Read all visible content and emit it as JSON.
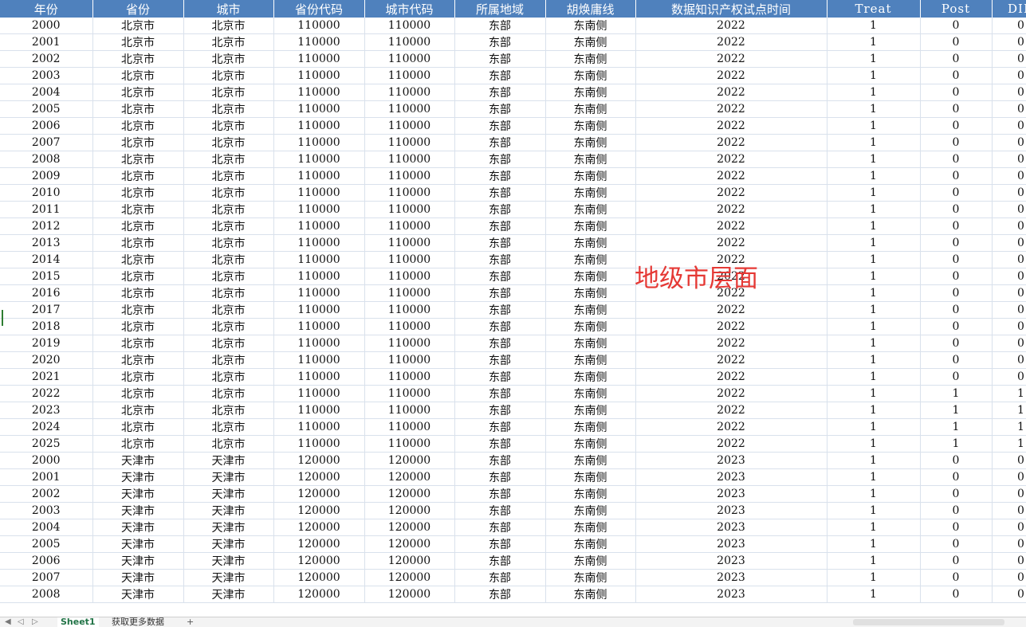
{
  "headers": [
    "年份",
    "省份",
    "城市",
    "省份代码",
    "城市代码",
    "所属地域",
    "胡焕庸线",
    "数据知识产权试点时间",
    "Treat",
    "Post",
    "DID"
  ],
  "rows": [
    [
      "2000",
      "北京市",
      "北京市",
      "110000",
      "110000",
      "东部",
      "东南侧",
      "2022",
      "1",
      "0",
      "0"
    ],
    [
      "2001",
      "北京市",
      "北京市",
      "110000",
      "110000",
      "东部",
      "东南侧",
      "2022",
      "1",
      "0",
      "0"
    ],
    [
      "2002",
      "北京市",
      "北京市",
      "110000",
      "110000",
      "东部",
      "东南侧",
      "2022",
      "1",
      "0",
      "0"
    ],
    [
      "2003",
      "北京市",
      "北京市",
      "110000",
      "110000",
      "东部",
      "东南侧",
      "2022",
      "1",
      "0",
      "0"
    ],
    [
      "2004",
      "北京市",
      "北京市",
      "110000",
      "110000",
      "东部",
      "东南侧",
      "2022",
      "1",
      "0",
      "0"
    ],
    [
      "2005",
      "北京市",
      "北京市",
      "110000",
      "110000",
      "东部",
      "东南侧",
      "2022",
      "1",
      "0",
      "0"
    ],
    [
      "2006",
      "北京市",
      "北京市",
      "110000",
      "110000",
      "东部",
      "东南侧",
      "2022",
      "1",
      "0",
      "0"
    ],
    [
      "2007",
      "北京市",
      "北京市",
      "110000",
      "110000",
      "东部",
      "东南侧",
      "2022",
      "1",
      "0",
      "0"
    ],
    [
      "2008",
      "北京市",
      "北京市",
      "110000",
      "110000",
      "东部",
      "东南侧",
      "2022",
      "1",
      "0",
      "0"
    ],
    [
      "2009",
      "北京市",
      "北京市",
      "110000",
      "110000",
      "东部",
      "东南侧",
      "2022",
      "1",
      "0",
      "0"
    ],
    [
      "2010",
      "北京市",
      "北京市",
      "110000",
      "110000",
      "东部",
      "东南侧",
      "2022",
      "1",
      "0",
      "0"
    ],
    [
      "2011",
      "北京市",
      "北京市",
      "110000",
      "110000",
      "东部",
      "东南侧",
      "2022",
      "1",
      "0",
      "0"
    ],
    [
      "2012",
      "北京市",
      "北京市",
      "110000",
      "110000",
      "东部",
      "东南侧",
      "2022",
      "1",
      "0",
      "0"
    ],
    [
      "2013",
      "北京市",
      "北京市",
      "110000",
      "110000",
      "东部",
      "东南侧",
      "2022",
      "1",
      "0",
      "0"
    ],
    [
      "2014",
      "北京市",
      "北京市",
      "110000",
      "110000",
      "东部",
      "东南侧",
      "2022",
      "1",
      "0",
      "0"
    ],
    [
      "2015",
      "北京市",
      "北京市",
      "110000",
      "110000",
      "东部",
      "东南侧",
      "2022",
      "1",
      "0",
      "0"
    ],
    [
      "2016",
      "北京市",
      "北京市",
      "110000",
      "110000",
      "东部",
      "东南侧",
      "2022",
      "1",
      "0",
      "0"
    ],
    [
      "2017",
      "北京市",
      "北京市",
      "110000",
      "110000",
      "东部",
      "东南侧",
      "2022",
      "1",
      "0",
      "0"
    ],
    [
      "2018",
      "北京市",
      "北京市",
      "110000",
      "110000",
      "东部",
      "东南侧",
      "2022",
      "1",
      "0",
      "0"
    ],
    [
      "2019",
      "北京市",
      "北京市",
      "110000",
      "110000",
      "东部",
      "东南侧",
      "2022",
      "1",
      "0",
      "0"
    ],
    [
      "2020",
      "北京市",
      "北京市",
      "110000",
      "110000",
      "东部",
      "东南侧",
      "2022",
      "1",
      "0",
      "0"
    ],
    [
      "2021",
      "北京市",
      "北京市",
      "110000",
      "110000",
      "东部",
      "东南侧",
      "2022",
      "1",
      "0",
      "0"
    ],
    [
      "2022",
      "北京市",
      "北京市",
      "110000",
      "110000",
      "东部",
      "东南侧",
      "2022",
      "1",
      "1",
      "1"
    ],
    [
      "2023",
      "北京市",
      "北京市",
      "110000",
      "110000",
      "东部",
      "东南侧",
      "2022",
      "1",
      "1",
      "1"
    ],
    [
      "2024",
      "北京市",
      "北京市",
      "110000",
      "110000",
      "东部",
      "东南侧",
      "2022",
      "1",
      "1",
      "1"
    ],
    [
      "2025",
      "北京市",
      "北京市",
      "110000",
      "110000",
      "东部",
      "东南侧",
      "2022",
      "1",
      "1",
      "1"
    ],
    [
      "2000",
      "天津市",
      "天津市",
      "120000",
      "120000",
      "东部",
      "东南侧",
      "2023",
      "1",
      "0",
      "0"
    ],
    [
      "2001",
      "天津市",
      "天津市",
      "120000",
      "120000",
      "东部",
      "东南侧",
      "2023",
      "1",
      "0",
      "0"
    ],
    [
      "2002",
      "天津市",
      "天津市",
      "120000",
      "120000",
      "东部",
      "东南侧",
      "2023",
      "1",
      "0",
      "0"
    ],
    [
      "2003",
      "天津市",
      "天津市",
      "120000",
      "120000",
      "东部",
      "东南侧",
      "2023",
      "1",
      "0",
      "0"
    ],
    [
      "2004",
      "天津市",
      "天津市",
      "120000",
      "120000",
      "东部",
      "东南侧",
      "2023",
      "1",
      "0",
      "0"
    ],
    [
      "2005",
      "天津市",
      "天津市",
      "120000",
      "120000",
      "东部",
      "东南侧",
      "2023",
      "1",
      "0",
      "0"
    ],
    [
      "2006",
      "天津市",
      "天津市",
      "120000",
      "120000",
      "东部",
      "东南侧",
      "2023",
      "1",
      "0",
      "0"
    ],
    [
      "2007",
      "天津市",
      "天津市",
      "120000",
      "120000",
      "东部",
      "东南侧",
      "2023",
      "1",
      "0",
      "0"
    ],
    [
      "2008",
      "天津市",
      "天津市",
      "120000",
      "120000",
      "东部",
      "东南侧",
      "2023",
      "1",
      "0",
      "0"
    ]
  ],
  "overlay_text": "地级市层面",
  "tabs": {
    "active": "Sheet1",
    "other": "获取更多数据",
    "add": "+"
  },
  "colors": {
    "header_bg": "#4f81bd",
    "overlay": "#e53935",
    "active_tab": "#217346"
  }
}
